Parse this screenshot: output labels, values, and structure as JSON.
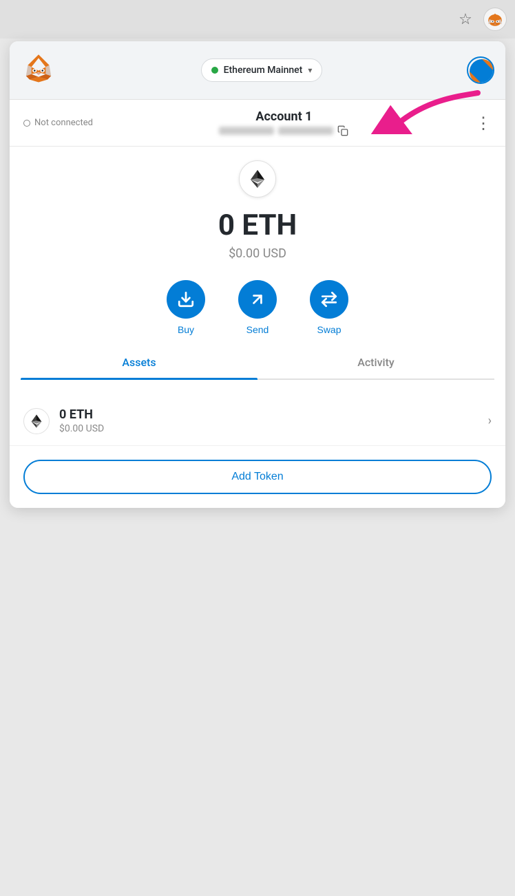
{
  "browser": {
    "star_icon": "☆",
    "fox_emoji": "🦊"
  },
  "header": {
    "network_label": "Ethereum Mainnet",
    "network_dot_color": "#28a745"
  },
  "account": {
    "connection_status": "Not connected",
    "name": "Account 1",
    "more_options_icon": "⋮"
  },
  "balance": {
    "eth_amount": "0 ETH",
    "usd_amount": "$0.00 USD"
  },
  "actions": {
    "buy_label": "Buy",
    "send_label": "Send",
    "swap_label": "Swap"
  },
  "tabs": {
    "assets_label": "Assets",
    "activity_label": "Activity"
  },
  "asset_item": {
    "eth_amount": "0 ETH",
    "usd_amount": "$0.00 USD"
  },
  "add_token": {
    "label": "Add Token"
  }
}
